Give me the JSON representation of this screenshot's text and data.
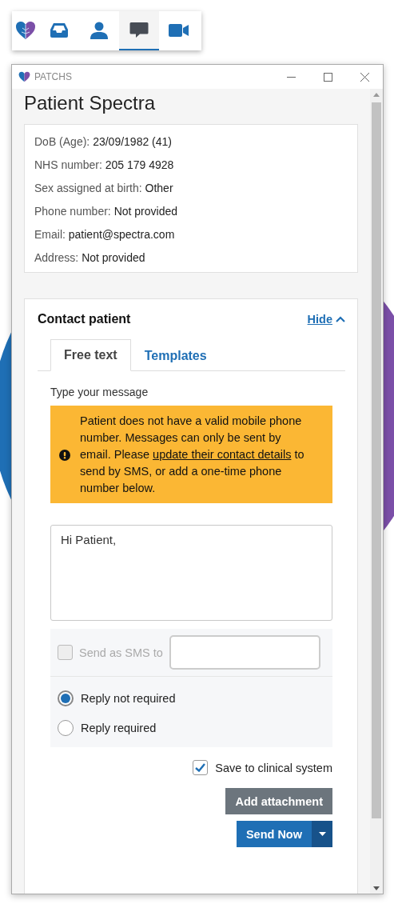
{
  "toolbar": {
    "items": [
      {
        "kind": "logo",
        "selected": false
      },
      {
        "kind": "inbox",
        "selected": false
      },
      {
        "kind": "person",
        "selected": false
      },
      {
        "kind": "chat",
        "selected": true
      },
      {
        "kind": "video",
        "selected": false
      }
    ]
  },
  "window": {
    "title": "PATCHS"
  },
  "patient": {
    "name": "Patient Spectra",
    "details": [
      {
        "label": "DoB (Age):",
        "value": "23/09/1982 (41)"
      },
      {
        "label": "NHS number:",
        "value": "205 179 4928"
      },
      {
        "label": "Sex assigned at birth:",
        "value": "Other"
      },
      {
        "label": "Phone number:",
        "value": "Not provided"
      },
      {
        "label": "Email:",
        "value": "patient@spectra.com"
      },
      {
        "label": "Address:",
        "value": "Not provided"
      }
    ]
  },
  "contact": {
    "title": "Contact patient",
    "toggle": "Hide",
    "expanded": true,
    "tabs": [
      {
        "label": "Free text",
        "selected": true
      },
      {
        "label": "Templates",
        "selected": false
      }
    ],
    "message_label": "Type your message",
    "warning": {
      "before": "Patient does not have a valid mobile phone number. Messages can only be sent by email. Please ",
      "link": "update their contact details",
      "after": " to send by SMS, or add a one-time phone number below."
    },
    "message": "Hi Patient,",
    "sms": {
      "label": "Send as SMS to",
      "checked": false,
      "disabled": true
    },
    "reply_options": [
      {
        "label": "Reply not required",
        "selected": true
      },
      {
        "label": "Reply required",
        "selected": false
      }
    ],
    "save": {
      "label": "Save to clinical system",
      "checked": true
    },
    "attach_button": "Add attachment",
    "send_button": "Send Now"
  }
}
